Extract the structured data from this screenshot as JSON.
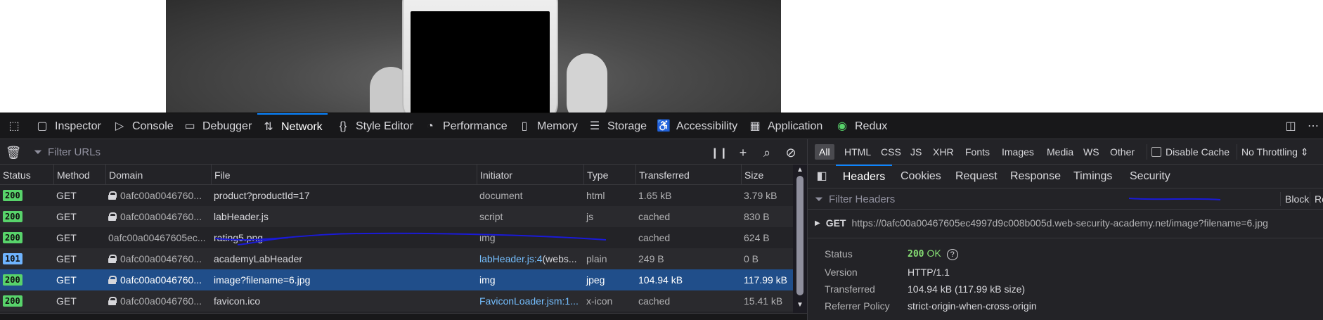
{
  "toolbox": {
    "tabs": [
      {
        "label": "Inspector",
        "icon": "inspector-icon"
      },
      {
        "label": "Console",
        "icon": "console-icon"
      },
      {
        "label": "Debugger",
        "icon": "debugger-icon"
      },
      {
        "label": "Network",
        "icon": "network-icon",
        "active": true
      },
      {
        "label": "Style Editor",
        "icon": "style-editor-icon"
      },
      {
        "label": "Performance",
        "icon": "performance-icon"
      },
      {
        "label": "Memory",
        "icon": "memory-icon"
      },
      {
        "label": "Storage",
        "icon": "storage-icon"
      },
      {
        "label": "Accessibility",
        "icon": "accessibility-icon"
      },
      {
        "label": "Application",
        "icon": "application-icon"
      },
      {
        "label": "Redux",
        "icon": "redux-icon"
      }
    ]
  },
  "network": {
    "filter_placeholder": "Filter URLs",
    "columns": [
      "Status",
      "Method",
      "Domain",
      "File",
      "Initiator",
      "Type",
      "Transferred",
      "Size"
    ],
    "rows": [
      {
        "status": "200",
        "method": "GET",
        "secure": true,
        "domain": "0afc00a0046760...",
        "file": "product?productId=17",
        "initiator": "document",
        "initiator_link": false,
        "type": "html",
        "transferred": "1.65 kB",
        "size": "3.79 kB"
      },
      {
        "status": "200",
        "method": "GET",
        "secure": true,
        "domain": "0afc00a0046760...",
        "file": "labHeader.js",
        "initiator": "script",
        "initiator_link": false,
        "type": "js",
        "transferred": "cached",
        "size": "830 B"
      },
      {
        "status": "200",
        "method": "GET",
        "secure": false,
        "domain": "0afc00a00467605ec...",
        "file": "rating5.png",
        "initiator": "img",
        "initiator_link": false,
        "type": "",
        "transferred": "cached",
        "size": "624 B"
      },
      {
        "status": "101",
        "method": "GET",
        "secure": true,
        "domain": "0afc00a0046760...",
        "file": "academyLabHeader",
        "initiator": "labHeader.js:4",
        "initiator_extra": " (webs...",
        "initiator_link": true,
        "type": "plain",
        "transferred": "249 B",
        "size": "0 B"
      },
      {
        "status": "200",
        "method": "GET",
        "secure": true,
        "domain": "0afc00a0046760...",
        "file": "image?filename=6.jpg",
        "initiator": "img",
        "initiator_link": false,
        "type": "jpeg",
        "transferred": "104.94 kB",
        "size": "117.99 kB",
        "selected": true
      },
      {
        "status": "200",
        "method": "GET",
        "secure": true,
        "domain": "0afc00a0046760...",
        "file": "favicon.ico",
        "initiator": "FaviconLoader.jsm:1...",
        "initiator_link": true,
        "type": "x-icon",
        "transferred": "cached",
        "size": "15.41 kB"
      }
    ]
  },
  "side": {
    "type_filters": [
      "All",
      "HTML",
      "CSS",
      "JS",
      "XHR",
      "Fonts",
      "Images",
      "Media",
      "WS",
      "Other"
    ],
    "disable_cache": "Disable Cache",
    "throttling": "No Throttling ⇕",
    "tabs": [
      "Headers",
      "Cookies",
      "Request",
      "Response",
      "Timings",
      "Security"
    ],
    "filter_headers_placeholder": "Filter Headers",
    "block_label": "Block",
    "resend_label": "Re",
    "request": {
      "method": "GET",
      "url": "https://0afc00a00467605ec4997d9c008b005d.web-security-academy.net/image?filename=6.jpg"
    },
    "details": {
      "status_label": "Status",
      "status_code": "200",
      "status_text": "OK",
      "version_label": "Version",
      "version": "HTTP/1.1",
      "transferred_label": "Transferred",
      "transferred": "104.94 kB (117.99 kB size)",
      "referrer_label": "Referrer Policy",
      "referrer": "strict-origin-when-cross-origin"
    }
  },
  "colors": {
    "accent": "#0a84ff",
    "selected_row": "#204e8a",
    "annotation": "#1a1ad8"
  }
}
